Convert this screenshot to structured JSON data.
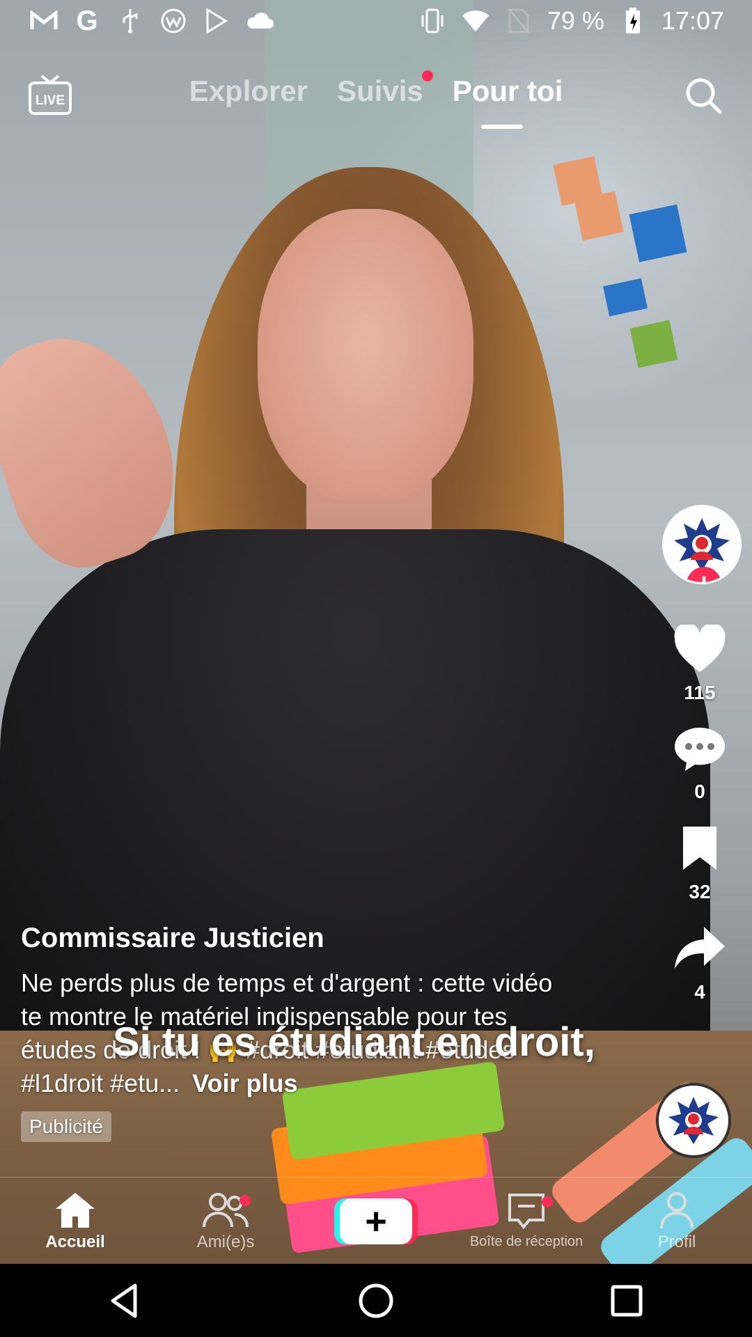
{
  "status_bar": {
    "battery_percent": "79 %",
    "time": "17:07",
    "icons_left": [
      "gmail-icon",
      "google-icon",
      "usb-icon",
      "wifi-app-icon",
      "play-store-icon",
      "cloud-icon"
    ],
    "icons_right": [
      "vibrate-icon",
      "wifi-signal-icon",
      "no-sim-icon",
      "battery-charging-icon"
    ]
  },
  "top_bar": {
    "live_label": "LIVE",
    "tabs": [
      {
        "label": "Explorer",
        "active": false,
        "dot": false
      },
      {
        "label": "Suivis",
        "active": false,
        "dot": true
      },
      {
        "label": "Pour toi",
        "active": true,
        "dot": false
      }
    ]
  },
  "video": {
    "author": "Commissaire Justicien",
    "description": "Ne perds plus de temps et d'argent : cette vidéo te montre le matériel indispensable pour tes études de droit ! 🙌 #droit #etudiant #etudes #l1droit #etu...",
    "see_more": "Voir plus",
    "ad_label": "Publicité",
    "subtitle": "Si tu es étudiant en droit,"
  },
  "rail": {
    "likes": "115",
    "comments": "0",
    "saves": "32",
    "shares": "4"
  },
  "bottom_nav": [
    {
      "label": "Accueil",
      "active": true,
      "dot": false
    },
    {
      "label": "Ami(e)s",
      "active": false,
      "dot": true
    },
    {
      "label": "",
      "active": false,
      "dot": false
    },
    {
      "label": "Boîte de réception",
      "active": false,
      "dot": true
    },
    {
      "label": "Profil",
      "active": false,
      "dot": false
    }
  ],
  "colors": {
    "accent_red": "#fe2c55",
    "accent_cyan": "#25f4ee"
  }
}
